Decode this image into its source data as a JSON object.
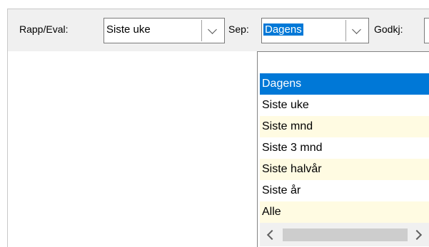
{
  "toolbar": {
    "rapp_label": "Rapp/Eval:",
    "rapp_value": "Siste uke",
    "sep_label": "Sep:",
    "sep_value": "Dagens",
    "godkj_label": "Godkj:"
  },
  "dropdown": {
    "options": [
      {
        "label": "Dagens",
        "selected": true
      },
      {
        "label": "Siste uke",
        "selected": false
      },
      {
        "label": "Siste mnd",
        "selected": false
      },
      {
        "label": "Siste 3 mnd",
        "selected": false
      },
      {
        "label": "Siste halvår",
        "selected": false
      },
      {
        "label": "Siste år",
        "selected": false
      },
      {
        "label": "Alle",
        "selected": false
      }
    ]
  },
  "colors": {
    "selection": "#0078d7",
    "alt_row": "#fffbe2",
    "toolbar_bg": "#f0f0f0"
  },
  "icons": {
    "combo_button": "chevron-down-icon",
    "scroll_left": "chevron-left-icon",
    "scroll_right": "chevron-right-icon"
  }
}
